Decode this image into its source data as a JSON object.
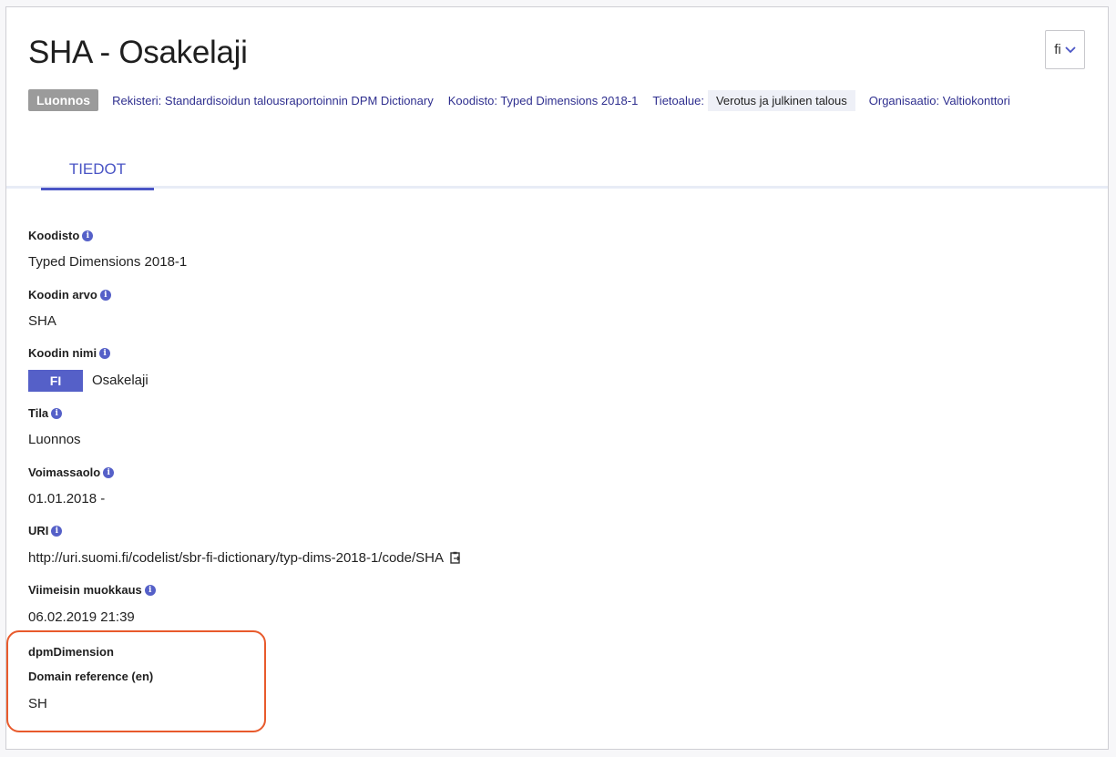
{
  "header": {
    "title": "SHA - Osakelaji",
    "language_selector": "fi"
  },
  "meta": {
    "status": "Luonnos",
    "registry": "Rekisteri: Standardisoidun talousraportoinnin DPM Dictionary",
    "codelist": "Koodisto: Typed Dimensions 2018-1",
    "domain_label": "Tietoalue:",
    "domain_value": "Verotus ja julkinen talous",
    "organization": "Organisaatio: Valtiokonttori"
  },
  "tabs": [
    {
      "label": "TIEDOT",
      "active": true
    }
  ],
  "fields": {
    "codelist": {
      "label": "Koodisto",
      "value": "Typed Dimensions 2018-1"
    },
    "code_value": {
      "label": "Koodin arvo",
      "value": "SHA"
    },
    "code_name": {
      "label": "Koodin nimi",
      "lang": "FI",
      "value": "Osakelaji"
    },
    "status": {
      "label": "Tila",
      "value": "Luonnos"
    },
    "validity": {
      "label": "Voimassaolo",
      "value": "01.01.2018 -"
    },
    "uri": {
      "label": "URI",
      "value": "http://uri.suomi.fi/codelist/sbr-fi-dictionary/typ-dims-2018-1/code/SHA"
    },
    "modified": {
      "label": "Viimeisin muokkaus",
      "value": "06.02.2019 21:39"
    }
  },
  "extension": {
    "title": "dpmDimension",
    "label": "Domain reference (en)",
    "value": "SH"
  },
  "colors": {
    "accent": "#5560c8",
    "highlight": "#e85a2c",
    "badge_gray": "#9b9b9b"
  }
}
